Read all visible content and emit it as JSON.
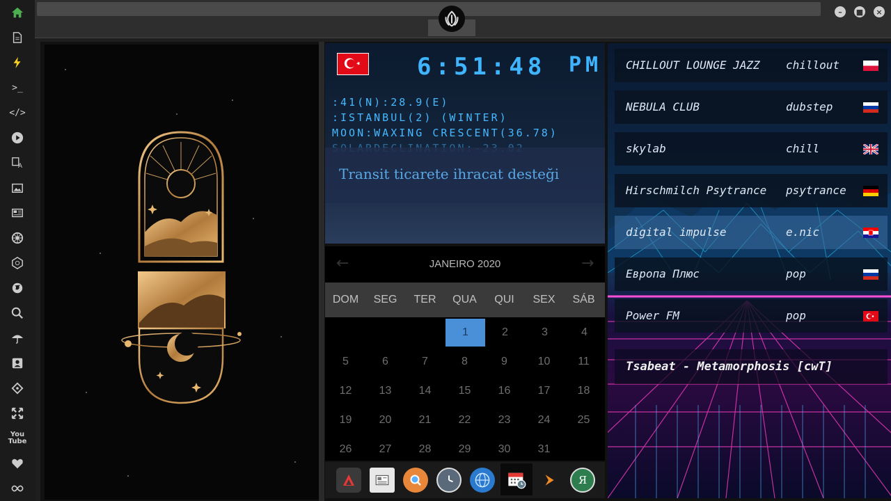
{
  "sidebar": {
    "items": [
      {
        "icon": "home-icon"
      },
      {
        "icon": "document-icon"
      },
      {
        "icon": "lightning-icon"
      },
      {
        "icon": "terminal-icon"
      },
      {
        "icon": "code-icon"
      },
      {
        "icon": "play-icon"
      },
      {
        "icon": "translate-icon"
      },
      {
        "icon": "image-icon"
      },
      {
        "icon": "newspaper-icon"
      },
      {
        "icon": "rebel-alliance-icon"
      },
      {
        "icon": "galactic-empire-icon"
      },
      {
        "icon": "globe-icon"
      },
      {
        "icon": "search-icon"
      },
      {
        "icon": "umbrella-icon"
      },
      {
        "icon": "contact-card-icon"
      },
      {
        "icon": "tag-icon"
      },
      {
        "icon": "expand-icon"
      },
      {
        "icon": "youtube-icon"
      },
      {
        "icon": "heart-icon"
      },
      {
        "icon": "infinity-icon"
      }
    ]
  },
  "clock": {
    "time": "6:51:48",
    "ampm": "PM",
    "coords": ":41(N):28.9(E)",
    "location": ":ISTANBUL(2) (WINTER)",
    "moon": "MOON:WAXING CRESCENT(36.78)",
    "solar": "SOLARDECLINATION:-23.02",
    "news": "Transit ticarete ihracat desteği"
  },
  "calendar": {
    "title": "JANEIRO 2020",
    "weekdays": [
      "DOM",
      "SEG",
      "TER",
      "QUA",
      "QUI",
      "SEX",
      "SÁB"
    ],
    "days": [
      "1",
      "2",
      "3",
      "4",
      "5",
      "6",
      "7",
      "8",
      "9",
      "10",
      "11",
      "12",
      "13",
      "14",
      "15",
      "16",
      "17",
      "18",
      "19",
      "20",
      "21",
      "22",
      "23",
      "24",
      "25",
      "26",
      "27",
      "28",
      "29",
      "30",
      "31"
    ],
    "selected": "1"
  },
  "dock": {
    "items": [
      "app-launcher-icon",
      "news-reader-icon",
      "search-app-icon",
      "clock-app-icon",
      "browser-globe-icon",
      "calendar-app-icon",
      "media-play-icon",
      "yandex-icon"
    ]
  },
  "radio": {
    "stations": [
      {
        "name": "CHILLOUT LOUNGE JAZZ",
        "genre": "chillout",
        "flag": "poland-flag-icon"
      },
      {
        "name": "NEBULA CLUB",
        "genre": "dubstep",
        "flag": "russia-flag-icon"
      },
      {
        "name": "skylab",
        "genre": "chill",
        "flag": "uk-flag-icon"
      },
      {
        "name": "Hirschmilch Psytrance",
        "genre": "psytrance",
        "flag": "germany-flag-icon"
      },
      {
        "name": "digital impulse",
        "genre": "e.nic",
        "flag": "croatia-flag-icon"
      },
      {
        "name": "Европа Плюс",
        "genre": "pop",
        "flag": "russia-flag-icon"
      },
      {
        "name": "Power FM",
        "genre": "pop",
        "flag": "turkey-flag-icon"
      }
    ],
    "now_playing": "Tsabeat - Metamorphosis [cwT]"
  },
  "colors": {
    "accent": "#3fb4ff",
    "today": "#4a90d9",
    "home": "#4caf50",
    "lightning": "#f5d020"
  }
}
